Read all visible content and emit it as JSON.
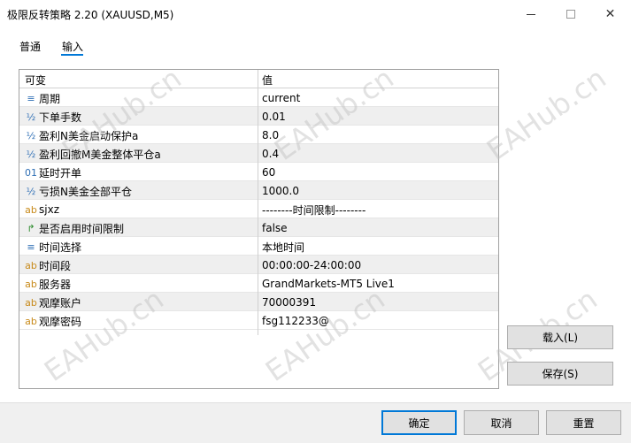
{
  "window": {
    "title": "极限反转策略 2.20 (XAUUSD,M5)",
    "minimize_icon": "minimize-icon",
    "maximize_icon": "maximize-icon",
    "close_glyph": "✕"
  },
  "tabs": [
    {
      "label": "普通"
    },
    {
      "label": "输入",
      "active": true
    }
  ],
  "table": {
    "header_name": "可变",
    "header_value": "值",
    "rows": [
      {
        "icon": "list-icon",
        "glyph": "≡",
        "name": "周期",
        "value": "current"
      },
      {
        "icon": "half-icon",
        "glyph": "½",
        "name": "下单手数",
        "value": "0.01"
      },
      {
        "icon": "half-icon",
        "glyph": "½",
        "name": "盈利N美金启动保护a",
        "value": "8.0"
      },
      {
        "icon": "half-icon",
        "glyph": "½",
        "name": "盈利回撤M美金整体平仓a",
        "value": "0.4"
      },
      {
        "icon": "int-icon",
        "glyph": "01",
        "name": "延时开单",
        "value": "60"
      },
      {
        "icon": "half-icon",
        "glyph": "½",
        "name": "亏损N美金全部平仓",
        "value": "1000.0"
      },
      {
        "icon": "string-icon",
        "glyph": "ab",
        "name": "sjxz",
        "value": "--------时间限制--------"
      },
      {
        "icon": "bool-icon",
        "glyph": "↱",
        "name": "是否启用时间限制",
        "value": "false"
      },
      {
        "icon": "list-icon",
        "glyph": "≡",
        "name": "时间选择",
        "value": "本地时间"
      },
      {
        "icon": "string-icon",
        "glyph": "ab",
        "name": "时间段",
        "value": "00:00:00-24:00:00"
      },
      {
        "icon": "string-icon",
        "glyph": "ab",
        "name": "服务器",
        "value": "GrandMarkets-MT5 Live1"
      },
      {
        "icon": "string-icon",
        "glyph": "ab",
        "name": "观摩账户",
        "value": "70000391"
      },
      {
        "icon": "string-icon",
        "glyph": "ab",
        "name": "观摩密码",
        "value": "fsg112233@"
      }
    ]
  },
  "buttons": {
    "load": "载入(L)",
    "save": "保存(S)",
    "ok": "确定",
    "cancel": "取消",
    "reset": "重置"
  },
  "watermark": "EAHub.cn",
  "colors": {
    "accent": "#0078d7",
    "row_alt": "#efefef",
    "icon_blue": "#2f6fb5",
    "icon_orange": "#c88a1a",
    "icon_green": "#2a8a2a"
  }
}
